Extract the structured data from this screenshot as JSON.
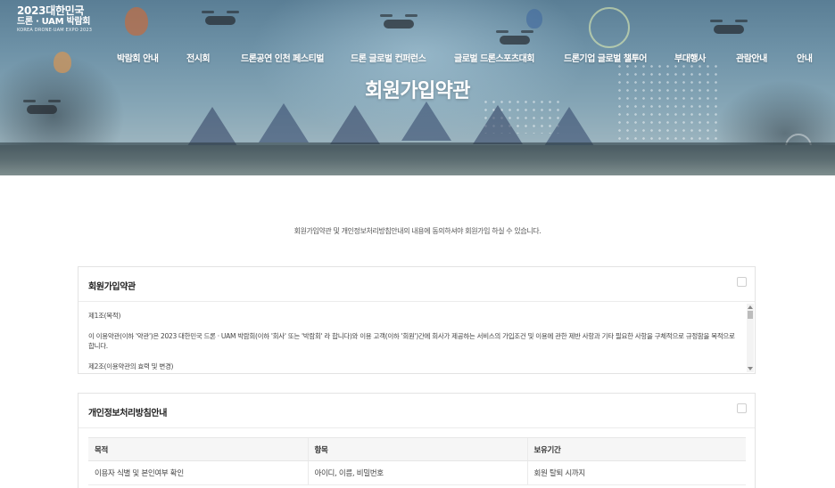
{
  "logo": {
    "line1": "2023대한민국",
    "line2": "드론 · UAM 박람회",
    "line3": "KOREA DRONE·UAM EXPO 2023"
  },
  "nav": {
    "items": [
      {
        "label": "박람회 안내"
      },
      {
        "label": "전시회"
      },
      {
        "label": "드론공연 인천 페스티벌"
      },
      {
        "label": "드론 글로벌 컨퍼런스"
      },
      {
        "label": "글로벌 드론스포츠대회"
      },
      {
        "label": "드론기업 글로벌 챌투어"
      },
      {
        "label": "부대행사"
      },
      {
        "label": "관람안내"
      },
      {
        "label": "안내"
      }
    ]
  },
  "hero": {
    "title": "회원가입약관"
  },
  "intro": "회원가입약관 및 개인정보처리방침안내의 내용에 동의하셔야 회원가입 하실 수 있습니다.",
  "terms_box": {
    "title": "회원가입약관",
    "article1_title": "제1조(목적)",
    "article1_body": "이 이용약관(이하 '약관')은 2023 대한민국 드론 · UAM 박람회(이하  '회사'  또는  '박람회' 라 합니다)와 이용 고객(이하 '회원')간에 회사가 제공하는 서비스의 가입조건 및 이용에 관한 제반 사항과 기타 필요한 사항을 구체적으로 규정함을 목적으로 합니다.",
    "article2_title": "제2조(이용약관의 효력 및 변경)"
  },
  "privacy_box": {
    "title": "개인정보처리방침안내",
    "columns": [
      "목적",
      "항목",
      "보유기간"
    ],
    "rows": [
      [
        "이용자 식별 및 본인여부 확인",
        "아이디, 이름, 비밀번호",
        "회원 탈퇴 시까지"
      ]
    ]
  },
  "colors": {
    "hero_sky": "#6f93a8",
    "header_text": "#ffffff",
    "table_header_bg": "#f6f6f6",
    "border": "#e3e3e3"
  }
}
